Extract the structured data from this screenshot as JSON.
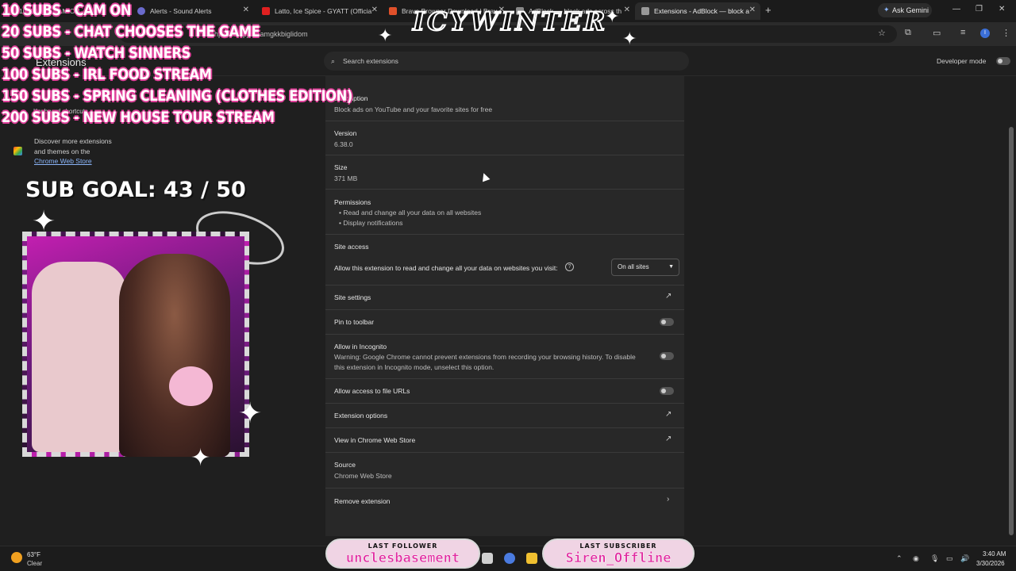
{
  "browser": {
    "tabs": [
      {
        "label": "10 SUBS - CAM ON",
        "x": 0
      },
      {
        "label": "Alerts - Sound Alerts"
      },
      {
        "label": "Latto, Ice Spice - GYATT (Officia"
      },
      {
        "label": "Brave Browser Download | Brav"
      },
      {
        "label": "AdBlock — block ads across th"
      },
      {
        "label": "Extensions - AdBlock — block a"
      }
    ],
    "new_tab_label": "+",
    "ask_gemini": "Ask Gemini",
    "url_fragment": "hpiobklfepjocnamgkkbiglidom"
  },
  "extensions_page": {
    "title": "Extensions",
    "search_placeholder": "Search extensions",
    "developer_mode_label": "Developer mode",
    "sidebar": {
      "keyboard_shortcuts": "Keyboard shortcuts",
      "discover_line1": "Discover more extensions",
      "discover_line2": "and themes on the",
      "discover_link": "Chrome Web Store"
    },
    "details": {
      "description_label": "Description",
      "description_value": "Block ads on YouTube and your favorite sites for free",
      "version_label": "Version",
      "version_value": "6.38.0",
      "size_label": "Size",
      "size_value": "371 MB",
      "permissions_label": "Permissions",
      "permissions": [
        "Read and change all your data on all websites",
        "Display notifications"
      ],
      "site_access_label": "Site access",
      "site_access_text": "Allow this extension to read and change all your data on websites you visit:",
      "site_access_value": "On all sites",
      "site_settings": "Site settings",
      "pin_to_toolbar": "Pin to toolbar",
      "allow_incognito": "Allow in Incognito",
      "incognito_warning_1": "Warning: Google Chrome cannot prevent extensions from recording your browsing history. To disable",
      "incognito_warning_2": "this extension in Incognito mode, unselect this option.",
      "file_urls": "Allow access to file URLs",
      "extension_options": "Extension options",
      "view_in_store": "View in Chrome Web Store",
      "source_label": "Source",
      "source_value": "Chrome Web Store",
      "remove_extension": "Remove extension"
    }
  },
  "overlay": {
    "goals": [
      "10 SUBS - CAM ON",
      "20 SUBS - CHAT CHOOSES THE GAME",
      "50 SUBS - WATCH SINNERS",
      "100 SUBS - IRL FOOD STREAM",
      "150 SUBS - SPRING CLEANING (CLOTHES EDITION)",
      "200 SUBS - NEW HOUSE TOUR STREAM"
    ],
    "logo": "ICYWINTER",
    "sub_goal": "SUB GOAL: 43 / 50",
    "last_follower_title": "LAST FOLLOWER",
    "last_follower_name": "unclesbasement",
    "last_subscriber_title": "LAST SUBSCRIBER",
    "last_subscriber_name": "Siren_Offline"
  },
  "taskbar": {
    "temperature": "63°F",
    "weather": "Clear",
    "time": "3:40 AM",
    "date": "3/30/2026"
  },
  "colors": {
    "accent": "#8ab4f8",
    "overlay_pink": "#e0409a"
  }
}
